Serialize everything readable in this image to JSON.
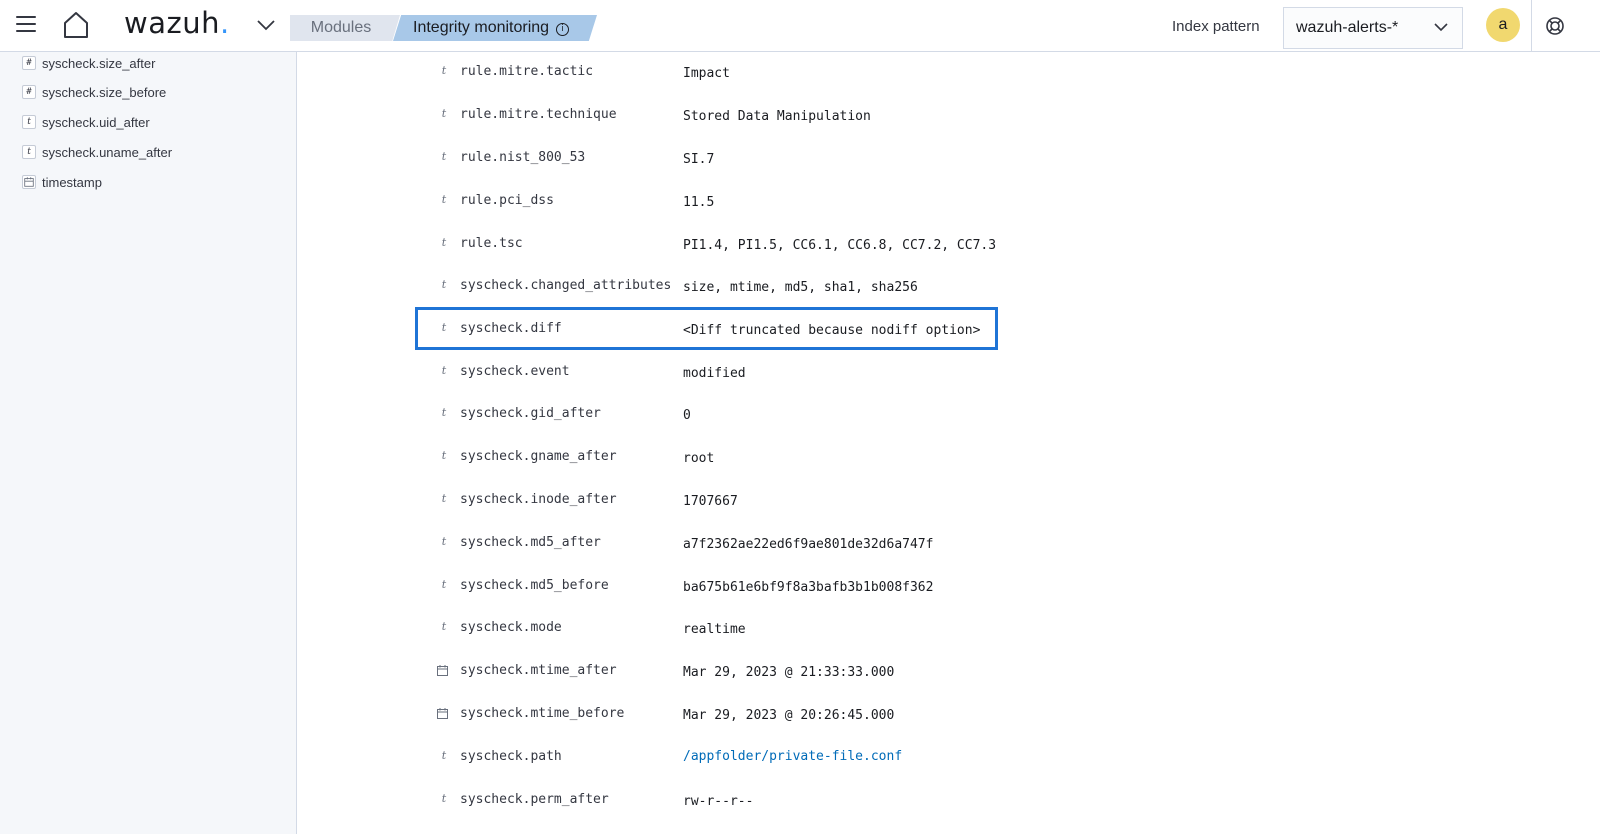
{
  "header": {
    "logo_text": "wazuh",
    "logo_dot": ".",
    "breadcrumbs": [
      "Modules",
      "Integrity monitoring"
    ],
    "info_glyph": "i",
    "index_pattern_label": "Index pattern",
    "index_pattern_value": "wazuh-alerts-*",
    "avatar_letter": "a",
    "icons": [
      "menu-icon",
      "home-icon",
      "chevron-down-icon",
      "info-icon",
      "help-icon"
    ]
  },
  "sidebar": {
    "fields": [
      {
        "type": "#",
        "name": "syscheck.size_after"
      },
      {
        "type": "#",
        "name": "syscheck.size_before"
      },
      {
        "type": "t",
        "name": "syscheck.uid_after"
      },
      {
        "type": "t",
        "name": "syscheck.uname_after"
      },
      {
        "type": "date",
        "name": "timestamp"
      }
    ]
  },
  "document": {
    "rows": [
      {
        "type": "t",
        "key": "rule.mitre.tactic",
        "value": "Impact"
      },
      {
        "type": "t",
        "key": "rule.mitre.technique",
        "value": "Stored Data Manipulation"
      },
      {
        "type": "t",
        "key": "rule.nist_800_53",
        "value": "SI.7"
      },
      {
        "type": "t",
        "key": "rule.pci_dss",
        "value": "11.5"
      },
      {
        "type": "t",
        "key": "rule.tsc",
        "value": "PI1.4, PI1.5, CC6.1, CC6.8, CC7.2, CC7.3"
      },
      {
        "type": "t",
        "key": "syscheck.changed_attributes",
        "value": "size, mtime, md5, sha1, sha256"
      },
      {
        "type": "t",
        "key": "syscheck.diff",
        "value": "<Diff truncated because nodiff option>",
        "highlighted": true
      },
      {
        "type": "t",
        "key": "syscheck.event",
        "value": "modified"
      },
      {
        "type": "t",
        "key": "syscheck.gid_after",
        "value": "0"
      },
      {
        "type": "t",
        "key": "syscheck.gname_after",
        "value": "root"
      },
      {
        "type": "t",
        "key": "syscheck.inode_after",
        "value": "1707667"
      },
      {
        "type": "t",
        "key": "syscheck.md5_after",
        "value": "a7f2362ae22ed6f9ae801de32d6a747f"
      },
      {
        "type": "t",
        "key": "syscheck.md5_before",
        "value": "ba675b61e6bf9f8a3bafb3b1b008f362"
      },
      {
        "type": "t",
        "key": "syscheck.mode",
        "value": "realtime"
      },
      {
        "type": "date",
        "key": "syscheck.mtime_after",
        "value": "Mar 29, 2023 @ 21:33:33.000"
      },
      {
        "type": "date",
        "key": "syscheck.mtime_before",
        "value": "Mar 29, 2023 @ 20:26:45.000"
      },
      {
        "type": "t",
        "key": "syscheck.path",
        "value": "/appfolder/private-file.conf",
        "link": true
      },
      {
        "type": "t",
        "key": "syscheck.perm_after",
        "value": "rw-r--r--"
      }
    ]
  },
  "colors": {
    "accent": "#3595f9",
    "highlight_border": "#1f74d6",
    "link": "#006bb8",
    "avatar_bg": "#f1d86f",
    "breadcrumb_active_bg": "#a8c8e8"
  }
}
